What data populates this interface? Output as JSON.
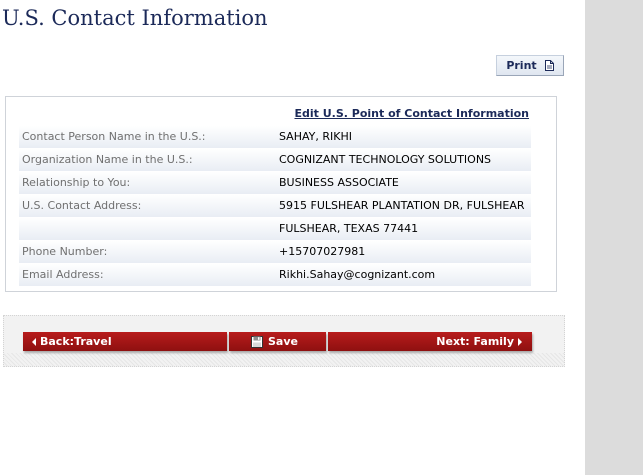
{
  "page": {
    "title": "U.S. Contact Information"
  },
  "toolbar": {
    "print_label": "Print",
    "print_icon": "document-icon"
  },
  "contact": {
    "edit_link": "Edit U.S. Point of Contact Information",
    "rows": [
      {
        "label": "Contact Person Name in the U.S.:",
        "value": "SAHAY, RIKHI"
      },
      {
        "label": "Organization Name in the U.S.:",
        "value": "COGNIZANT TECHNOLOGY SOLUTIONS"
      },
      {
        "label": "Relationship to You:",
        "value": "BUSINESS ASSOCIATE"
      },
      {
        "label": "U.S. Contact Address:",
        "value": "5915 FULSHEAR PLANTATION DR, FULSHEAR"
      },
      {
        "label": "",
        "value": "FULSHEAR, TEXAS 77441"
      },
      {
        "label": "Phone Number:",
        "value": "+15707027981"
      },
      {
        "label": "Email Address:",
        "value": "Rikhi.Sahay@cognizant.com"
      }
    ]
  },
  "nav": {
    "back_label": "Back:Travel",
    "save_label": "Save",
    "next_label": "Next: Family",
    "back_icon": "triangle-left-icon",
    "save_icon": "floppy-disk-icon",
    "next_icon": "triangle-right-icon"
  },
  "colors": {
    "title_navy": "#1c2a59",
    "nav_red": "#a31616",
    "label_gray": "#707070",
    "side_panel": "#dcdcdc"
  }
}
